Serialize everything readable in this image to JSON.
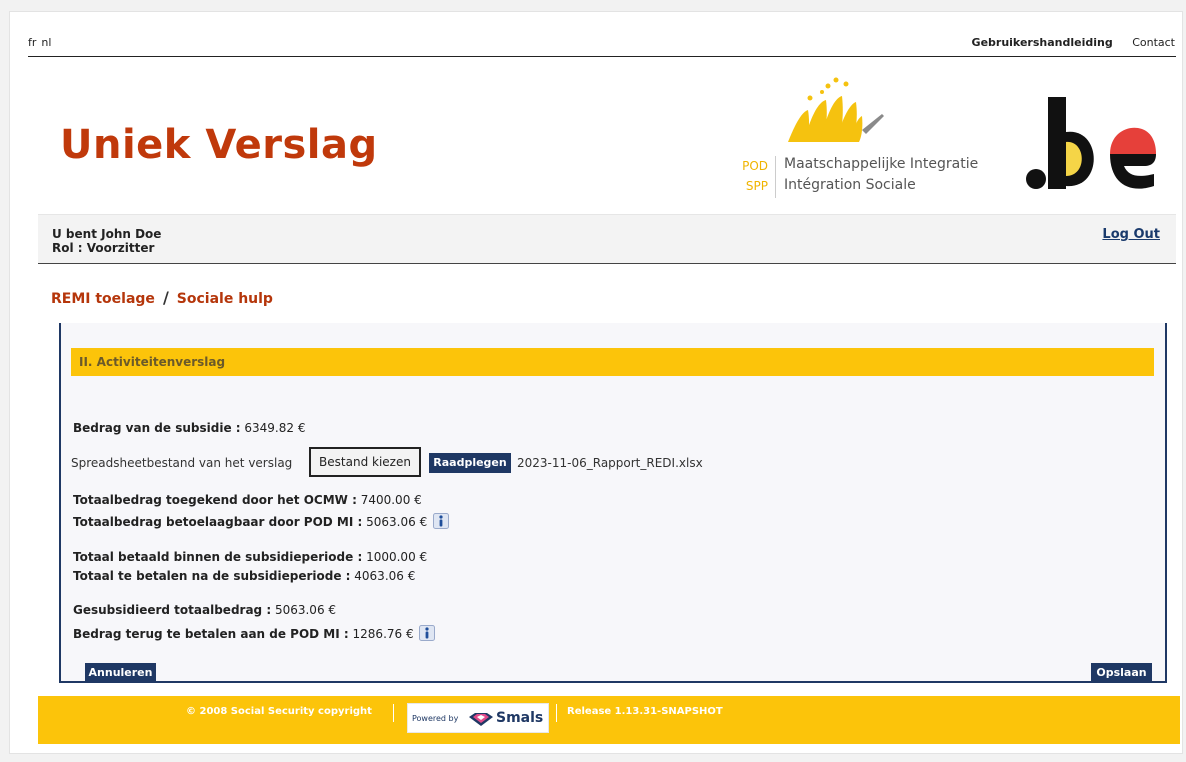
{
  "top": {
    "languages": [
      "fr",
      "nl"
    ],
    "manual_link": "Gebruikershandleiding",
    "contact_link": "Contact"
  },
  "header": {
    "title": "Uniek Verslag",
    "pod_label_nl": "POD",
    "pod_label_fr": "SPP",
    "pod_name_nl": "Maatschappelijke Integratie",
    "pod_name_fr": "Intégration Sociale",
    "brand_color": "#c0390b",
    "accent_color": "#fcc40a"
  },
  "user": {
    "name_line": "U bent John Doe",
    "role_line": "Rol : Voorzitter",
    "logout": "Log Out"
  },
  "breadcrumb": {
    "item1": "REMI toelage",
    "separator": "/",
    "item2": "Sociale hulp"
  },
  "section": {
    "title": "II. Activiteitenverslag"
  },
  "form": {
    "subsidy_label": "Bedrag van de subsidie :",
    "subsidy_value": "6349.82 €",
    "file_label": "Spreadsheetbestand van het verslag",
    "choose_button": "Bestand kiezen",
    "consult_button": "Raadplegen",
    "file_name": "2023-11-06_Rapport_REDI.xlsx",
    "ocmw_label": "Totaalbedrag toegekend door het OCMW :",
    "ocmw_value": "7400.00 €",
    "eligible_label": "Totaalbedrag betoelaagbaar door POD MI :",
    "eligible_value": "5063.06 €",
    "paid_label": "Totaal betaald binnen de subsidieperiode :",
    "paid_value": "1000.00 €",
    "topay_label": "Totaal te betalen na de subsidieperiode :",
    "topay_value": "4063.06 €",
    "subsidized_label": "Gesubsidieerd totaalbedrag :",
    "subsidized_value": "5063.06 €",
    "refund_label": "Bedrag terug te betalen aan de POD MI :",
    "refund_value": "1286.76 €",
    "cancel_button": "Annuleren",
    "save_button": "Opslaan"
  },
  "footer": {
    "copyright": "© 2008 Social Security copyright",
    "powered_by": "Powered by",
    "smals": "Smals",
    "release": "Release 1.13.31-SNAPSHOT"
  }
}
